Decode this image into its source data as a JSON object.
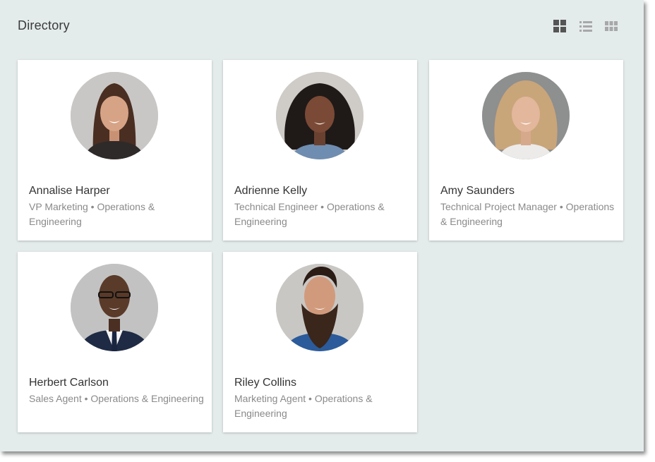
{
  "header": {
    "title": "Directory",
    "view_toggles": [
      "grid-large-view-icon",
      "list-view-icon",
      "grid-small-view-icon"
    ],
    "active_view": "grid-large"
  },
  "colors": {
    "panel_bg": "#e4ebeb",
    "card_bg": "#ffffff",
    "name_text": "#333333",
    "subtitle_text": "#8a8a8a",
    "active_icon": "#555555",
    "inactive_icon": "#a8a8a8"
  },
  "people": [
    {
      "name": "Annalise Harper",
      "subtitle": "VP Marketing • Operations & Engineering"
    },
    {
      "name": "Adrienne Kelly",
      "subtitle": "Technical Engineer • Operations & Engineering"
    },
    {
      "name": "Amy Saunders",
      "subtitle": "Technical Project Manager • Operations & Engineering"
    },
    {
      "name": "Herbert Carlson",
      "subtitle": "Sales Agent • Operations & Engineering"
    },
    {
      "name": "Riley Collins",
      "subtitle": "Marketing Agent • Operations & Engineering"
    }
  ]
}
